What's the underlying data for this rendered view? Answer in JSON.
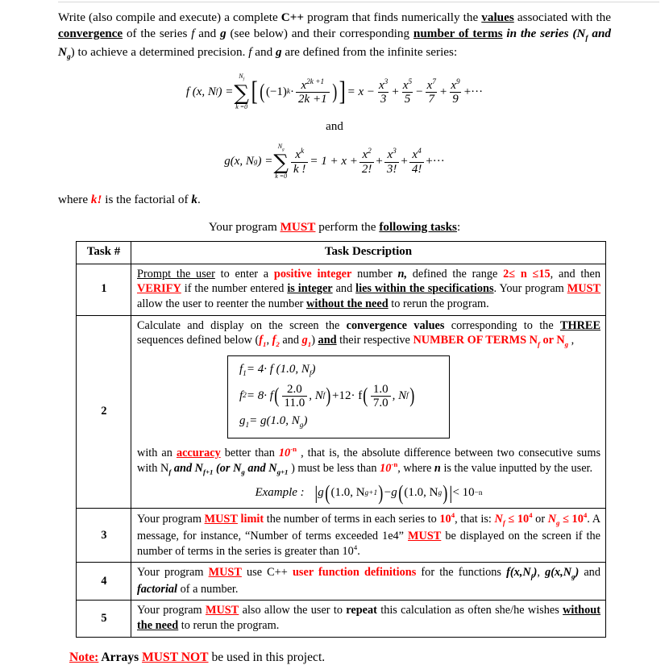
{
  "document": {
    "intro": {
      "line_parts": [
        "Write (also compile and execute) a complete ",
        "C++",
        " program that finds numerically the ",
        "values",
        " associated with the ",
        "convergence",
        " of the series ",
        "f",
        " and ",
        "g",
        " (see below) and their corresponding ",
        "number of terms",
        " in the series (N",
        "f",
        " and N",
        "g",
        ") to achieve a determined precision.  ",
        "f",
        " and ",
        "g",
        " are defined from the infinite series:"
      ]
    },
    "equation_f": {
      "lhs": "f (x, N",
      "lhs_sub": "f",
      "lhs_close": ") =",
      "sum_upper": "N",
      "sum_upper_sub": "f",
      "sum_lower": "k =0",
      "term_sign": "(−1)",
      "term_sign_exp": "k",
      "dot": "·",
      "term_num": "x",
      "term_num_exp": "2k +1",
      "term_den": "2k +1",
      "equals": "= x −",
      "expansion": [
        {
          "num": "x",
          "exp": "3",
          "den": "3",
          "op": "+"
        },
        {
          "num": "x",
          "exp": "5",
          "den": "5",
          "op": "−"
        },
        {
          "num": "x",
          "exp": "7",
          "den": "7",
          "op": "+"
        },
        {
          "num": "x",
          "exp": "9",
          "den": "9",
          "op": "+···"
        }
      ]
    },
    "and_label": "and",
    "equation_g": {
      "lhs": "g(x, N",
      "lhs_sub": "g",
      "lhs_close": ") =",
      "sum_upper": "N",
      "sum_upper_sub": "g",
      "sum_lower": "k =0",
      "term_num": "x",
      "term_num_exp": "k",
      "term_den": "k !",
      "equals": "= 1 + x +",
      "expansion": [
        {
          "num": "x",
          "exp": "2",
          "den": "2!",
          "op": "+"
        },
        {
          "num": "x",
          "exp": "3",
          "den": "3!",
          "op": "+"
        },
        {
          "num": "x",
          "exp": "4",
          "den": "4!",
          "op": "+···"
        }
      ]
    },
    "where_line": {
      "pre": "where ",
      "red_italic": "k!",
      "mid": " is the factorial of ",
      "bold_italic": "k",
      "post": "."
    },
    "must_perform": {
      "pre": "Your program ",
      "must": "MUST",
      "mid": " perform the ",
      "tasks": "following tasks",
      "post": ":"
    },
    "table": {
      "headers": [
        "Task #",
        "Task Description"
      ],
      "rows": [
        {
          "num": "1",
          "parts": [
            {
              "t": "Prompt the user",
              "s": "u"
            },
            {
              "t": " to enter a ",
              "s": ""
            },
            {
              "t": "positive integer",
              "s": "redb"
            },
            {
              "t": " number ",
              "s": ""
            },
            {
              "t": "n,",
              "s": "bi"
            },
            {
              "t": " defined the range ",
              "s": ""
            },
            {
              "t": "2≤ n ≤15",
              "s": "redb"
            },
            {
              "t": ", and then ",
              "s": ""
            },
            {
              "t": "VERIFY",
              "s": "redbu"
            },
            {
              "t": " if the number entered ",
              "s": ""
            },
            {
              "t": "is integer",
              "s": "bu"
            },
            {
              "t": " and ",
              "s": ""
            },
            {
              "t": "lies within the specifications",
              "s": "bu"
            },
            {
              "t": ". Your program ",
              "s": ""
            },
            {
              "t": "MUST",
              "s": "redbu"
            },
            {
              "t": " allow the user to reenter the number ",
              "s": ""
            },
            {
              "t": "without the need",
              "s": "bu"
            },
            {
              "t": " to rerun the program.",
              "s": ""
            }
          ]
        },
        {
          "num": "2",
          "parts_top": [
            {
              "t": "Calculate and display on the screen the ",
              "s": ""
            },
            {
              "t": "convergence values",
              "s": "b"
            },
            {
              "t": " corresponding to the ",
              "s": ""
            },
            {
              "t": "THREE",
              "s": "bu"
            },
            {
              "t": " sequences defined below (",
              "s": ""
            },
            {
              "t": "f",
              "s": "redbi"
            },
            {
              "t": "1",
              "s": "redbi-sub"
            },
            {
              "t": ", ",
              "s": ""
            },
            {
              "t": "f",
              "s": "redbi"
            },
            {
              "t": "2",
              "s": "redbi-sub"
            },
            {
              "t": " and ",
              "s": ""
            },
            {
              "t": "g",
              "s": "redbi"
            },
            {
              "t": "1",
              "s": "redbi-sub"
            },
            {
              "t": ") ",
              "s": ""
            },
            {
              "t": "and",
              "s": "bu"
            },
            {
              "t": " their respective ",
              "s": ""
            },
            {
              "t": "NUMBER OF TERMS N",
              "s": "redb"
            },
            {
              "t": "f",
              "s": "redb-sub"
            },
            {
              "t": " or N",
              "s": "redb"
            },
            {
              "t": "g",
              "s": "redb-sub"
            },
            {
              "t": " ,",
              "s": ""
            }
          ],
          "formula_box": {
            "f1": {
              "lhs": "f",
              "lhs_sub": "1",
              "rhs": "= 4· f (1.0, N",
              "rhs_sub": "f",
              "close": ")"
            },
            "f2": {
              "lhs": "f",
              "lhs_sub": "2",
              "eq": "= 8· f",
              "arg1_num": "2.0",
              "arg1_den": "11.0",
              "arg1_var": ", N",
              "arg1_sub": "f",
              "plus": "+12· f",
              "arg2_num": "1.0",
              "arg2_den": "7.0",
              "arg2_var": ", N",
              "arg2_sub": "f"
            },
            "g1": {
              "lhs": "g",
              "lhs_sub": "1",
              "rhs": "= g(1.0, N",
              "rhs_sub": "g",
              "close": ")"
            }
          },
          "parts_bottom": [
            {
              "t": "with an ",
              "s": ""
            },
            {
              "t": "accuracy",
              "s": "redbu"
            },
            {
              "t": " better than ",
              "s": ""
            },
            {
              "t": "10",
              "s": "red-ten"
            },
            {
              "t": "-n",
              "s": "red-ten-sup"
            },
            {
              "t": " , that is, the absolute difference between two consecutive sums with N",
              "s": ""
            },
            {
              "t": "f",
              "s": "bi-sub"
            },
            {
              "t": " and N",
              "s": "bi"
            },
            {
              "t": "f+1",
              "s": "bi-sub"
            },
            {
              "t": " (or N",
              "s": "bi"
            },
            {
              "t": "g",
              "s": "bi-sub"
            },
            {
              "t": " and N",
              "s": "bi"
            },
            {
              "t": "g+1",
              "s": "bi-sub"
            },
            {
              "t": " ) must be less than ",
              "s": ""
            },
            {
              "t": "10",
              "s": "red-ten"
            },
            {
              "t": "-n",
              "s": "red-ten-sup"
            },
            {
              "t": ", where ",
              "s": ""
            },
            {
              "t": "n",
              "s": "bi"
            },
            {
              "t": " is the value inputted by the user.",
              "s": ""
            }
          ],
          "example": {
            "label": "Example :",
            "expr_g1": "g",
            "a1": "(1.0, N",
            "a1_sub": "g+1",
            "a1_close": ")",
            "minus": "−",
            "expr_g2": "g",
            "a2": "(1.0, N",
            "a2_sub": "g",
            "a2_close": ")",
            "rel": "< 10",
            "rel_sup": "−n"
          }
        },
        {
          "num": "3",
          "parts": [
            {
              "t": "Your program ",
              "s": ""
            },
            {
              "t": "MUST",
              "s": "redbu"
            },
            {
              "t": " ",
              "s": ""
            },
            {
              "t": "limit",
              "s": "redb"
            },
            {
              "t": " the number of terms in each series to ",
              "s": ""
            },
            {
              "t": "10",
              "s": "redb"
            },
            {
              "t": "4",
              "s": "redb-sup"
            },
            {
              "t": ", that is:  ",
              "s": ""
            },
            {
              "t": "N",
              "s": "redbi"
            },
            {
              "t": "f",
              "s": "redbi-sub"
            },
            {
              "t": " ≤ 10",
              "s": "redb"
            },
            {
              "t": "4",
              "s": "redb-sup"
            },
            {
              "t": "      or ",
              "s": ""
            },
            {
              "t": "N",
              "s": "redbi"
            },
            {
              "t": "g",
              "s": "redbi-sub"
            },
            {
              "t": " ≤ 10",
              "s": "redb"
            },
            {
              "t": "4",
              "s": "redb-sup"
            },
            {
              "t": ". A message, for instance, “Number of terms exceeded 1e4” ",
              "s": ""
            },
            {
              "t": "MUST",
              "s": "redbu"
            },
            {
              "t": " be displayed on the screen if the number of terms in the series is greater than 10",
              "s": ""
            },
            {
              "t": "4",
              "s": "sup"
            },
            {
              "t": ".",
              "s": ""
            }
          ]
        },
        {
          "num": "4",
          "parts": [
            {
              "t": "Your program ",
              "s": ""
            },
            {
              "t": "MUST",
              "s": "redbu"
            },
            {
              "t": " use C++ ",
              "s": ""
            },
            {
              "t": "user function definitions",
              "s": "redb"
            },
            {
              "t": " for the functions ",
              "s": ""
            },
            {
              "t": "f(x,N",
              "s": "bi"
            },
            {
              "t": "f",
              "s": "bi-sub"
            },
            {
              "t": ")",
              "s": "bi"
            },
            {
              "t": ", ",
              "s": ""
            },
            {
              "t": "g(x,N",
              "s": "bi"
            },
            {
              "t": "g",
              "s": "bi-sub"
            },
            {
              "t": ")",
              "s": "bi"
            },
            {
              "t": " and ",
              "s": ""
            },
            {
              "t": "factorial",
              "s": "bi"
            },
            {
              "t": " of a number.",
              "s": ""
            }
          ]
        },
        {
          "num": "5",
          "parts": [
            {
              "t": "Your program ",
              "s": ""
            },
            {
              "t": "MUST",
              "s": "redbu"
            },
            {
              "t": " also allow the user to ",
              "s": ""
            },
            {
              "t": "repeat",
              "s": "b"
            },
            {
              "t": " this calculation as often she/he wishes ",
              "s": ""
            },
            {
              "t": "without the need",
              "s": "bu"
            },
            {
              "t": " to rerun the program.",
              "s": ""
            }
          ]
        }
      ]
    },
    "note": {
      "label": "Note:",
      "mid": " Arrays ",
      "emph": "MUST NOT",
      "post": " be used in this project."
    },
    "colors": {
      "red": "#ff0000",
      "text": "#000000",
      "border": "#000000",
      "background": "#ffffff"
    }
  }
}
